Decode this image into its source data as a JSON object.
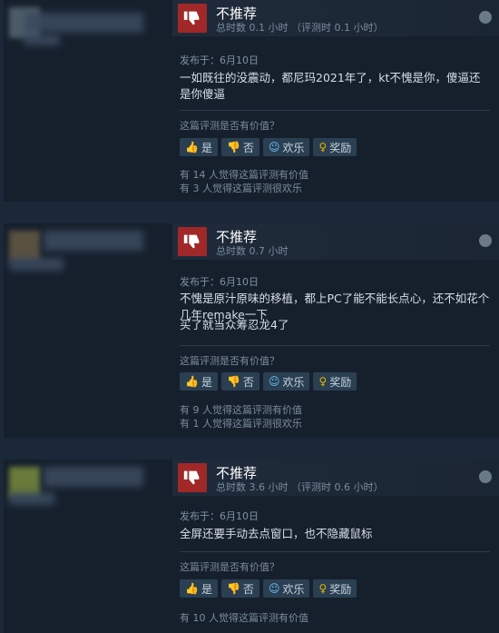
{
  "reviews": [
    {
      "title": "不推荐",
      "hours": "总时数 0.1 小时 （评测时 0.1 小时）",
      "posted": "发布于：6月10日",
      "text": "一如既往的没震动，都尼玛2021年了，kt不愧是你，傻逼还是你傻逼",
      "helpful_question": "这篇评测是否有价值？",
      "buttons": {
        "yes": "是",
        "no": "否",
        "funny": "欢乐",
        "award": "奖励"
      },
      "stats": [
        "有 14 人觉得这篇评测有价值",
        "有 3 人觉得这篇评测很欢乐"
      ]
    },
    {
      "title": "不推荐",
      "hours": "总时数 0.7 小时",
      "posted": "发布于：6月10日",
      "text": "不愧是原汁原味的移植，都上PC了能不能长点心，还不如花个几年remake一下",
      "text2": "买了就当众筹忍龙4了",
      "helpful_question": "这篇评测是否有价值？",
      "buttons": {
        "yes": "是",
        "no": "否",
        "funny": "欢乐",
        "award": "奖励"
      },
      "stats": [
        "有 9 人觉得这篇评测有价值",
        "有 1 人觉得这篇评测很欢乐"
      ]
    },
    {
      "title": "不推荐",
      "hours": "总时数 3.6 小时 （评测时 0.6 小时）",
      "posted": "发布于：6月10日",
      "text": "全屏还要手动去点窗口，也不隐藏鼠标",
      "helpful_question": "这篇评测是否有价值？",
      "buttons": {
        "yes": "是",
        "no": "否",
        "funny": "欢乐",
        "award": "奖励"
      },
      "stats": [
        "有 10 人觉得这篇评测有价值"
      ]
    }
  ]
}
